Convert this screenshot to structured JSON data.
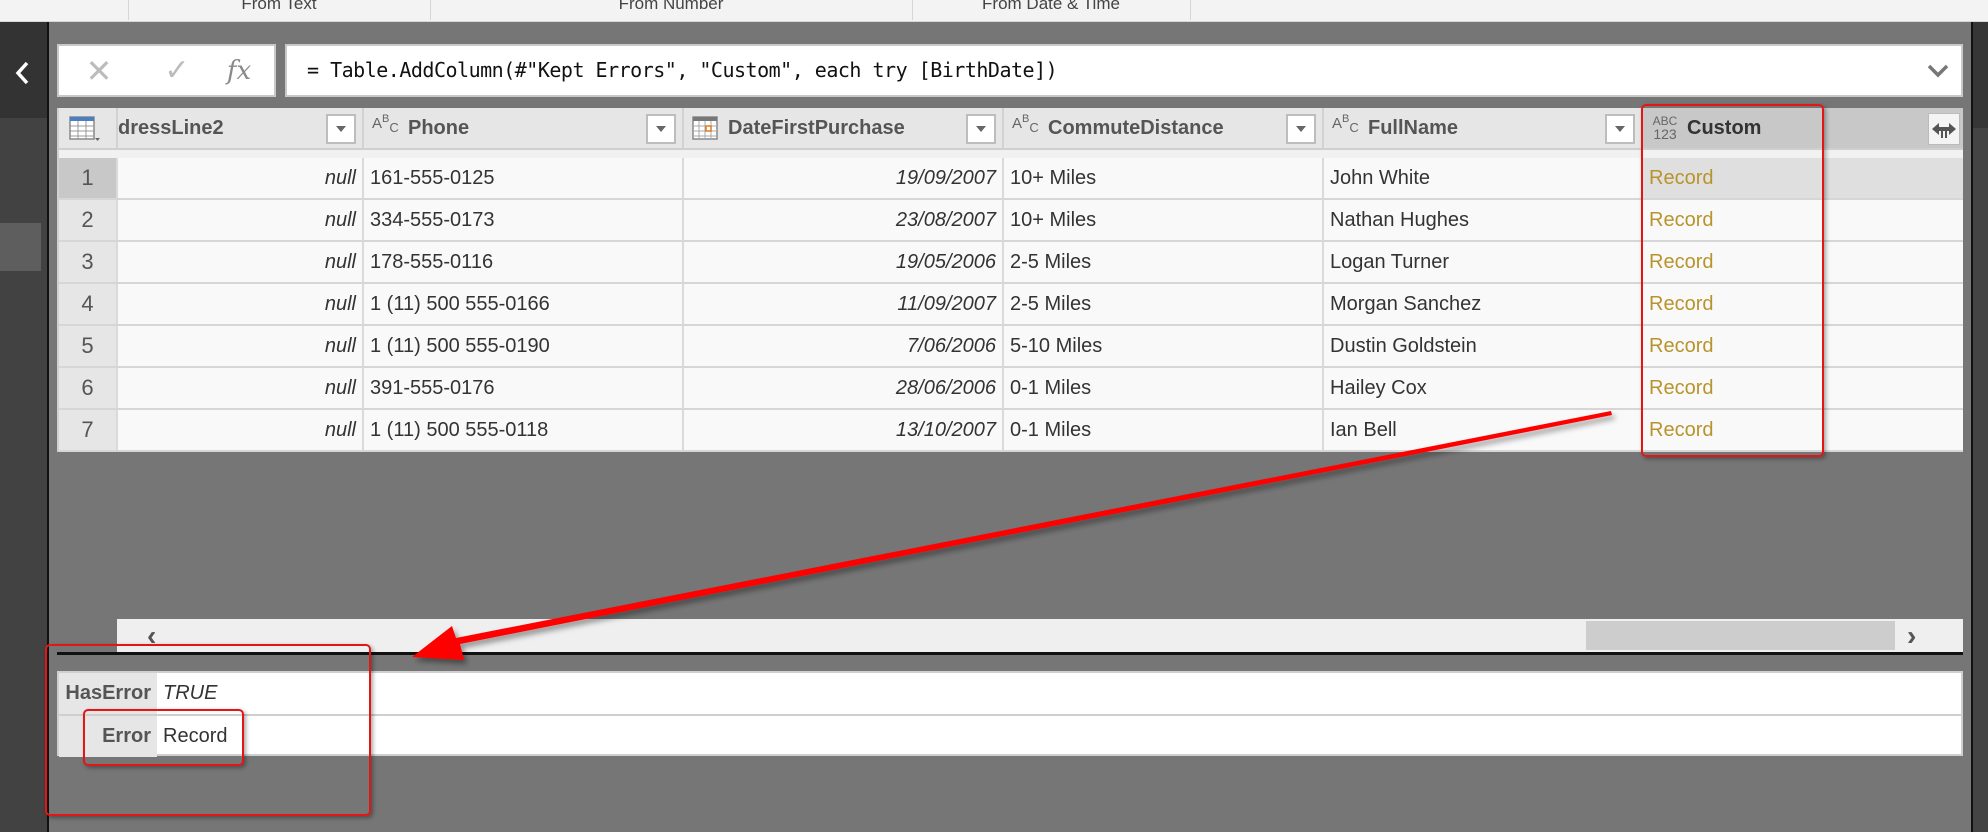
{
  "ribbon": {
    "groups": [
      "From Text",
      "From Number",
      "From Date & Time"
    ]
  },
  "leftnav": {
    "collapse_icon": "chevron-left-icon"
  },
  "formula_bar": {
    "cancel_icon": "✕",
    "commit_icon": "✓",
    "fx_label": "fx",
    "formula": "= Table.AddColumn(#\"Kept Errors\", \"Custom\", each try [BirthDate])",
    "expand_icon": "chevron-down-icon"
  },
  "grid": {
    "columns": [
      {
        "name": "dressLine2",
        "type": "any"
      },
      {
        "name": "Phone",
        "type": "text",
        "type_icon": "ABC"
      },
      {
        "name": "DateFirstPurchase",
        "type": "date"
      },
      {
        "name": "CommuteDistance",
        "type": "text",
        "type_icon": "ABC"
      },
      {
        "name": "FullName",
        "type": "text",
        "type_icon": "ABC"
      },
      {
        "name": "Custom",
        "type": "any",
        "type_icon": "ABC 123"
      }
    ],
    "rows": [
      {
        "n": "1",
        "addr2": "null",
        "phone": "161-555-0125",
        "date": "19/09/2007",
        "commute": "10+ Miles",
        "name": "John White",
        "custom": "Record"
      },
      {
        "n": "2",
        "addr2": "null",
        "phone": "334-555-0173",
        "date": "23/08/2007",
        "commute": "10+ Miles",
        "name": "Nathan Hughes",
        "custom": "Record"
      },
      {
        "n": "3",
        "addr2": "null",
        "phone": "178-555-0116",
        "date": "19/05/2006",
        "commute": "2-5 Miles",
        "name": "Logan Turner",
        "custom": "Record"
      },
      {
        "n": "4",
        "addr2": "null",
        "phone": "1 (11) 500 555-0166",
        "date": "11/09/2007",
        "commute": "2-5 Miles",
        "name": "Morgan Sanchez",
        "custom": "Record"
      },
      {
        "n": "5",
        "addr2": "null",
        "phone": "1 (11) 500 555-0190",
        "date": "7/06/2006",
        "commute": "5-10 Miles",
        "name": "Dustin Goldstein",
        "custom": "Record"
      },
      {
        "n": "6",
        "addr2": "null",
        "phone": "391-555-0176",
        "date": "28/06/2006",
        "commute": "0-1 Miles",
        "name": "Hailey Cox",
        "custom": "Record"
      },
      {
        "n": "7",
        "addr2": "null",
        "phone": "1 (11) 500 555-0118",
        "date": "13/10/2007",
        "commute": "0-1 Miles",
        "name": "Ian Bell",
        "custom": "Record"
      }
    ],
    "selected_row": 1,
    "selected_column": "Custom"
  },
  "scrollbar": {
    "left_arrow": "‹",
    "right_arrow": "›"
  },
  "details": [
    {
      "label": "HasError",
      "value": "TRUE",
      "italic": true
    },
    {
      "label": "Error",
      "value": "Record",
      "italic": false
    }
  ],
  "colors": {
    "record_link": "#b8942d",
    "annotation": "#e61515",
    "canvas": "#767676"
  }
}
